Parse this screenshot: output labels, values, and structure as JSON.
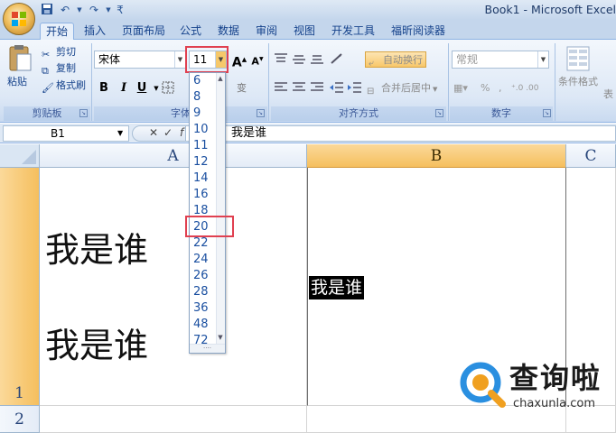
{
  "window": {
    "title": "Book1 - Microsoft Excel"
  },
  "quick_access": {
    "icons": [
      "save-icon",
      "undo-icon",
      "redo-icon",
      "customize-icon"
    ]
  },
  "tabs": [
    {
      "label": "开始",
      "active": true
    },
    {
      "label": "插入"
    },
    {
      "label": "页面布局"
    },
    {
      "label": "公式"
    },
    {
      "label": "数据"
    },
    {
      "label": "审阅"
    },
    {
      "label": "视图"
    },
    {
      "label": "开发工具"
    },
    {
      "label": "福昕阅读器"
    }
  ],
  "ribbon": {
    "clipboard": {
      "paste": "粘贴",
      "cut": "剪切",
      "copy": "复制",
      "format_painter": "格式刷",
      "group_label": "剪贴板"
    },
    "font": {
      "font_name": "宋体",
      "font_size": "11",
      "bold": "B",
      "italic": "I",
      "underline": "U",
      "grow": "A",
      "shrink": "A",
      "group_label": "字体"
    },
    "alignment": {
      "wrap_text": "自动换行",
      "merge_center": "合并后居中",
      "group_label": "对齐方式"
    },
    "number": {
      "format": "常规",
      "percent": "%",
      "comma": ",",
      "group_label": "数字"
    },
    "styles": {
      "conditional_format": "条件格式",
      "table_format": "表"
    }
  },
  "formula_bar": {
    "name_box": "B1",
    "content": "我是谁"
  },
  "grid": {
    "columns": [
      "A",
      "B",
      "C"
    ],
    "rows": [
      "1",
      "2"
    ],
    "selected_column": "B",
    "cells": {
      "A1_line1": "我是谁",
      "A1_line2": "我是谁",
      "B1": "我是谁"
    }
  },
  "font_size_dropdown": {
    "options": [
      "6",
      "8",
      "9",
      "10",
      "11",
      "12",
      "14",
      "16",
      "18",
      "20",
      "22",
      "24",
      "26",
      "28",
      "36",
      "48",
      "72"
    ],
    "highlighted": "20"
  },
  "watermark": {
    "text": "查询啦",
    "url": "chaxunla.com"
  },
  "colors": {
    "highlight_red": "#e04050",
    "selected_header": "#f5bf5e",
    "ribbon_blue": "#dde8f6"
  }
}
